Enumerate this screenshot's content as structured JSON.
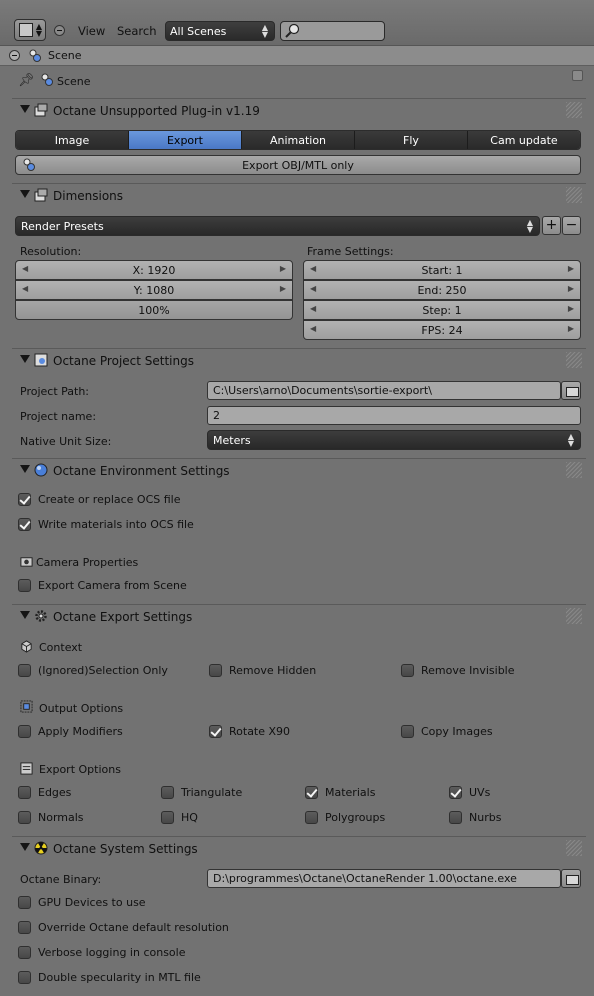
{
  "header": {
    "menus": [
      "View",
      "Search"
    ],
    "scene_filter": "All Scenes"
  },
  "breadcrumb": {
    "scene": "Scene"
  },
  "context": {
    "scene": "Scene"
  },
  "plugin_panel": {
    "title": "Octane Unsupported Plug-in v1.19",
    "tabs": [
      "Image",
      "Export",
      "Animation",
      "Fly",
      "Cam update"
    ],
    "active_tab": "Export",
    "export_button": "Export OBJ/MTL only"
  },
  "dimensions": {
    "title": "Dimensions",
    "preset": "Render Presets",
    "resolution_label": "Resolution:",
    "x": "X: 1920",
    "y": "Y: 1080",
    "percent": "100%",
    "frame_label": "Frame Settings:",
    "start": "Start: 1",
    "end": "End: 250",
    "step": "Step: 1",
    "fps": "FPS: 24"
  },
  "project": {
    "title": "Octane Project Settings",
    "path_label": "Project Path:",
    "path_value": "C:\\Users\\arno\\Documents\\sortie-export\\",
    "name_label": "Project name:",
    "name_value": "2",
    "unit_label": "Native Unit Size:",
    "unit_value": "Meters"
  },
  "environment": {
    "title": "Octane Environment Settings",
    "create_ocs": "Create or replace OCS file",
    "write_materials": "Write materials into OCS file",
    "camera_props": "Camera Properties",
    "export_camera": "Export Camera from Scene"
  },
  "export_settings": {
    "title": "Octane Export Settings",
    "context_label": "Context",
    "selection_only": "(Ignored)Selection Only",
    "remove_hidden": "Remove Hidden",
    "remove_invisible": "Remove Invisible",
    "output_label": "Output Options",
    "apply_modifiers": "Apply Modifiers",
    "rotate_x90": "Rotate X90",
    "copy_images": "Copy Images",
    "export_opts_label": "Export Options",
    "edges": "Edges",
    "triangulate": "Triangulate",
    "materials": "Materials",
    "uvs": "UVs",
    "normals": "Normals",
    "hq": "HQ",
    "polygroups": "Polygroups",
    "nurbs": "Nurbs"
  },
  "system": {
    "title": "Octane System Settings",
    "binary_label": "Octane Binary:",
    "binary_value": "D:\\programmes\\Octane\\OctaneRender 1.00\\octane.exe",
    "gpu": "GPU Devices to use",
    "override_res": "Override Octane default resolution",
    "verbose": "Verbose logging in console",
    "double_spec": "Double specularity in MTL file"
  },
  "checkbox_states": {
    "create_ocs": true,
    "write_materials": true,
    "export_camera": false,
    "selection_only": false,
    "remove_hidden": false,
    "remove_invisible": false,
    "apply_modifiers": false,
    "rotate_x90": true,
    "copy_images": false,
    "edges": false,
    "triangulate": false,
    "materials": true,
    "uvs": true,
    "normals": false,
    "hq": false,
    "polygroups": false,
    "nurbs": false,
    "gpu": false,
    "override_res": false,
    "verbose": false,
    "double_spec": false
  },
  "colors": {
    "active_tab": "#5b89d6",
    "panel_bg": "#727272"
  }
}
